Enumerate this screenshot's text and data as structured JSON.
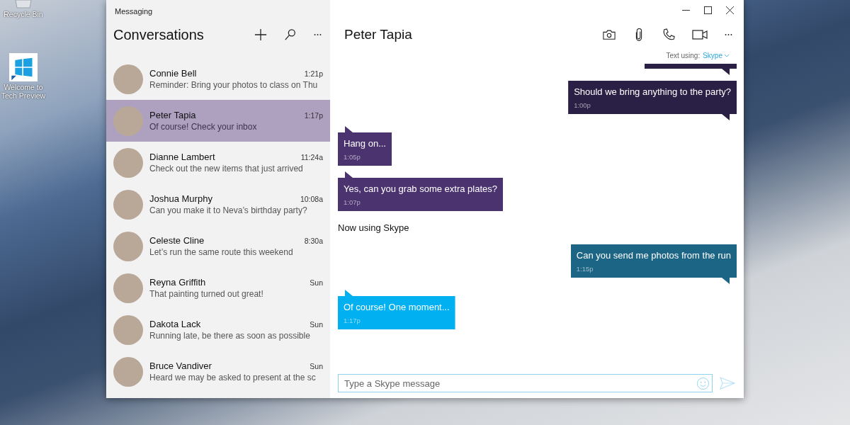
{
  "desktop": {
    "icons": [
      {
        "kind": "recycle",
        "label": "Recycle Bin"
      },
      {
        "kind": "windows",
        "label": "Welcome to Tech Preview"
      }
    ]
  },
  "window": {
    "title": "Messaging"
  },
  "conversations": {
    "title": "Conversations",
    "items": [
      {
        "name": "Connie Bell",
        "time": "1:21p",
        "preview": "Reminder: Bring your photos to class on Thu",
        "selected": false
      },
      {
        "name": "Peter Tapia",
        "time": "1:17p",
        "preview": "Of course! Check your inbox",
        "selected": true
      },
      {
        "name": "Dianne Lambert",
        "time": "11:24a",
        "preview": "Check out the new items that just arrived",
        "selected": false
      },
      {
        "name": "Joshua Murphy",
        "time": "10:08a",
        "preview": "Can you make it to Neva’s birthday party?",
        "selected": false
      },
      {
        "name": "Celeste Cline",
        "time": "8:30a",
        "preview": "Let’s run the same route this weekend",
        "selected": false
      },
      {
        "name": "Reyna Griffith",
        "time": "Sun",
        "preview": "That painting turned out great!",
        "selected": false
      },
      {
        "name": "Dakota Lack",
        "time": "Sun",
        "preview": "Running late, be there as soon as possible",
        "selected": false
      },
      {
        "name": "Bruce Vandiver",
        "time": "Sun",
        "preview": "Heard we may be asked to present at the sc",
        "selected": false
      }
    ]
  },
  "chat": {
    "contact": "Peter Tapia",
    "service_label": "Text using:",
    "service": "Skype",
    "messages": [
      {
        "kind": "partial",
        "color": "#2a1f44"
      },
      {
        "kind": "sent",
        "color": "#2a1f44",
        "text": "Should we bring anything to the party?",
        "time": "1:00p"
      },
      {
        "kind": "received",
        "color": "#4b3370",
        "text": "Hang on...",
        "time": "1:05p"
      },
      {
        "kind": "received",
        "color": "#4b3370",
        "text": "Yes, can you grab some extra plates?",
        "time": "1:07p"
      },
      {
        "kind": "notice",
        "text": "Now using Skype"
      },
      {
        "kind": "sent",
        "color": "#1d6585",
        "text": "Can you send me photos from the run",
        "time": "1:15p"
      },
      {
        "kind": "received",
        "color": "#00b0f0",
        "text": "Of course!  One moment...",
        "time": "1:17p"
      }
    ],
    "input": {
      "placeholder": "Type a Skype message"
    }
  }
}
